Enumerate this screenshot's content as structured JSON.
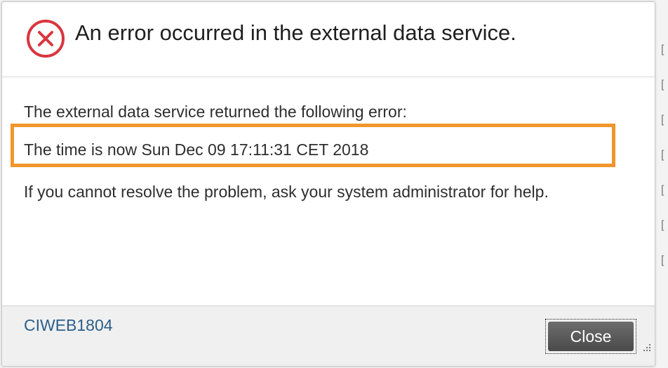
{
  "dialog": {
    "title": "An error occurred in the external data service.",
    "icon": "error-circle-x-icon",
    "intro": "The external data service returned the following error:",
    "error_detail": "The time is now Sun Dec 09 17:11:31 CET 2018",
    "advice": "If you cannot resolve the problem, ask your system administrator for help.",
    "error_code": "CIWEB1804",
    "close_label": "Close"
  },
  "colors": {
    "error_red": "#d9363e",
    "highlight_orange": "#f0962c",
    "link_blue": "#2c5f8a",
    "button_gray": "#5a5a5a"
  }
}
